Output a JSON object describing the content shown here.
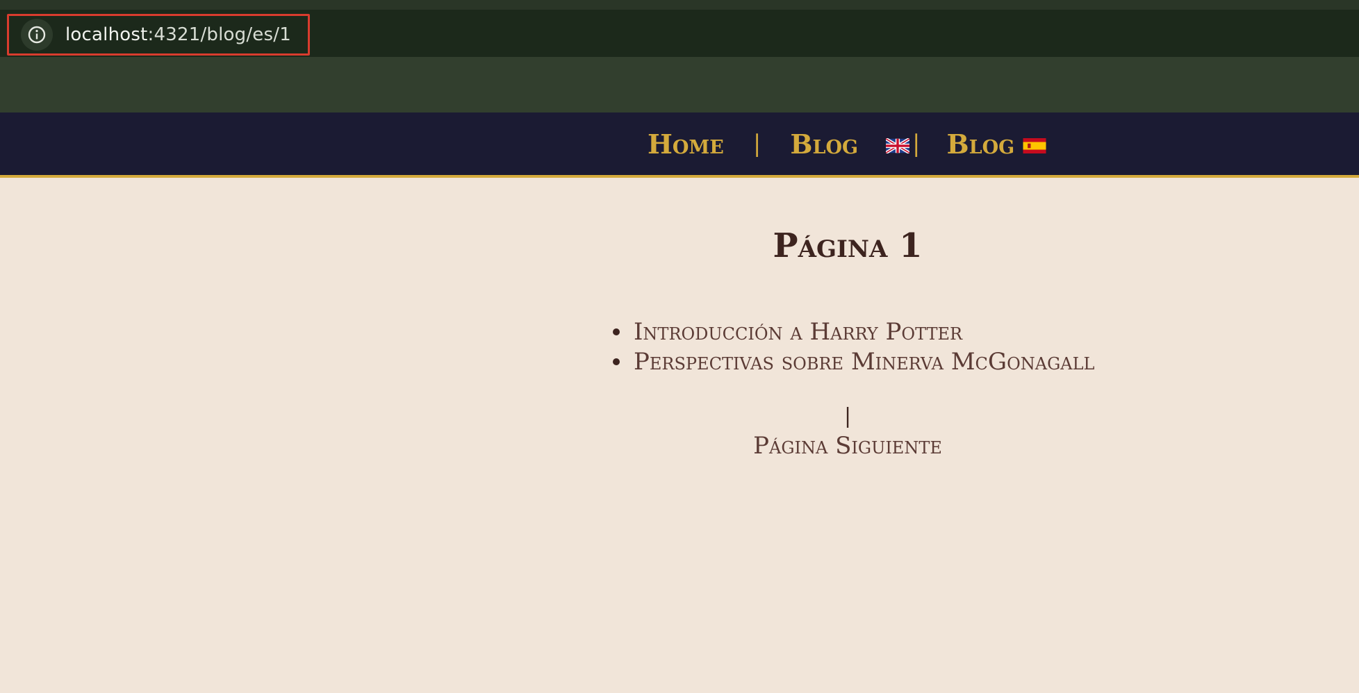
{
  "browser": {
    "url_host": "localhost",
    "url_path": ":4321/blog/es/1"
  },
  "nav": {
    "home": "Home",
    "separator": "|",
    "blog_en": "Blog",
    "blog_es": "Blog"
  },
  "page": {
    "title": "Página 1"
  },
  "posts": [
    "Introducción a Harry Potter",
    "Perspectivas sobre Minerva McGonagall"
  ],
  "pagination": {
    "separator": "|",
    "next_label": "Página Siguiente"
  },
  "colors": {
    "browser_bg": "#323f2e",
    "address_bar_bg": "#1c291b",
    "header_bg": "#1b1b33",
    "accent_gold": "#d4aa3c",
    "page_bg": "#f1e5d9",
    "text_dark": "#3d241f"
  }
}
